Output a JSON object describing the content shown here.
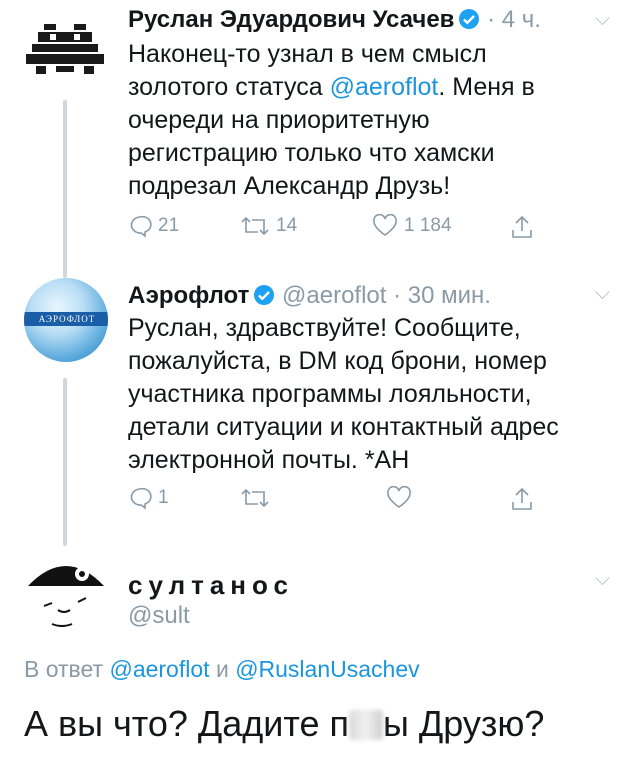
{
  "tweets": [
    {
      "name": "Руслан Эдуардович Усачев",
      "meta": "· 4 ч.",
      "lines": [
        "Наконец-то узнал в чем смысл",
        "золотого статуса ",
        "очереди на приоритетную",
        "регистрацию только что хамски",
        "подрезал Александр Друзь!"
      ],
      "mention": "@aeroflot",
      "mention_after": ". Меня в",
      "reply_count": "21",
      "retweet_count": "14",
      "like_count": "1 184"
    },
    {
      "name": "Аэрофлот",
      "handle": "@aeroflot",
      "meta": "· 30 мин.",
      "avatar_text": "АЭРОФЛОТ",
      "lines": [
        "Руслан, здравствуйте! Сообщите,",
        "пожалуйста, в DM код брони, номер",
        "участника программы лояльности,",
        "детали ситуации и контактный адрес",
        "электронной почты. *АН"
      ],
      "reply_count": "1"
    }
  ],
  "reply": {
    "name": "султанос",
    "handle": "@sult",
    "reply_prefix": "В ответ",
    "reply_mention1": "@aeroflot",
    "reply_and": "и",
    "reply_mention2": "@RuslanUsachev",
    "text_before": "А вы что? Дадите п",
    "text_after": "ы Друзю?"
  },
  "colors": {
    "accent": "#1b95e0",
    "muted": "#8a9aa6",
    "verified": "#1da1f2"
  }
}
